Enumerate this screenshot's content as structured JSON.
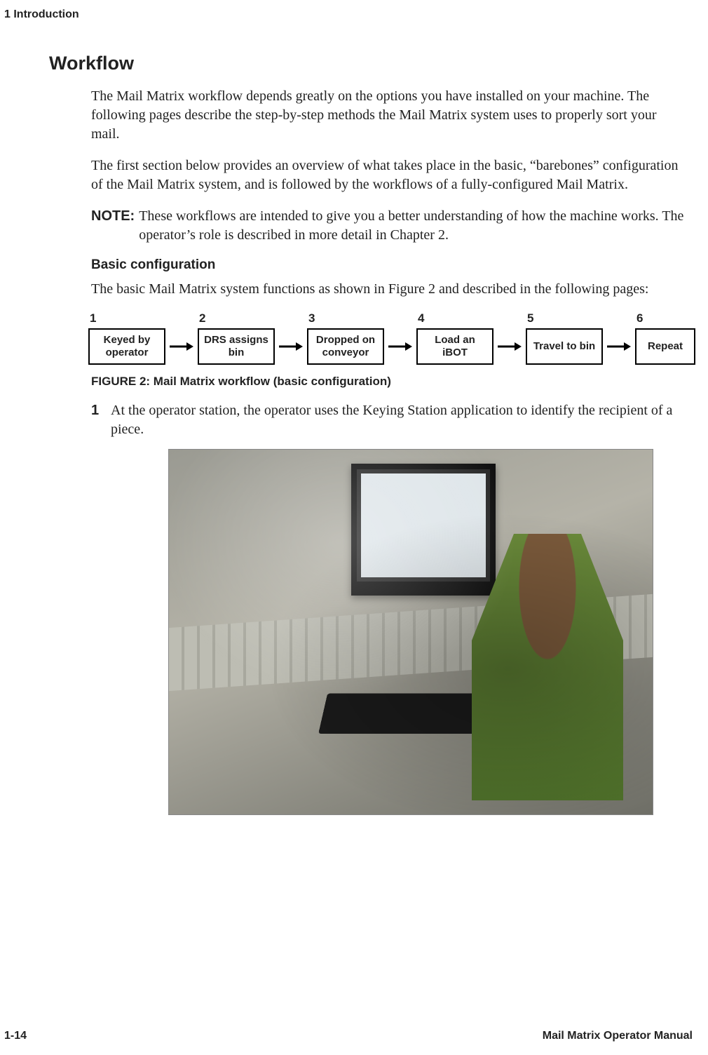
{
  "header": {
    "chapter": "1  Introduction"
  },
  "section": {
    "title": "Workflow"
  },
  "paragraphs": {
    "intro1": "The Mail Matrix workflow depends greatly on the options you have installed on your machine. The following pages describe the step-by-step methods the Mail Matrix system uses to properly sort your mail.",
    "intro2": "The first section below provides an overview of what takes place in the basic, “barebones” configuration of the Mail Matrix system, and is followed by the workflows of a fully-configured Mail Matrix.",
    "note_label": "NOTE:",
    "note_text": "These workflows are intended to give you a better understanding of how the machine works. The operator’s role is described in more detail in Chapter 2.",
    "subhead": "Basic configuration",
    "basic_intro": "The basic Mail Matrix system functions as shown in Figure 2 and described in the following pages:",
    "figure_caption": "FIGURE 2:  Mail Matrix workflow (basic configuration)",
    "step1_num": "1",
    "step1_text": "At the operator station, the operator uses the Keying Station application to identify the recipient of a piece."
  },
  "workflow_steps": [
    {
      "num": "1",
      "label": "Keyed by operator"
    },
    {
      "num": "2",
      "label": "DRS assigns bin"
    },
    {
      "num": "3",
      "label": "Dropped on conveyor"
    },
    {
      "num": "4",
      "label": "Load an iBOT"
    },
    {
      "num": "5",
      "label": "Travel to bin"
    },
    {
      "num": "6",
      "label": "Repeat"
    }
  ],
  "footer": {
    "page": "1-14",
    "doc": "Mail Matrix Operator Manual"
  }
}
